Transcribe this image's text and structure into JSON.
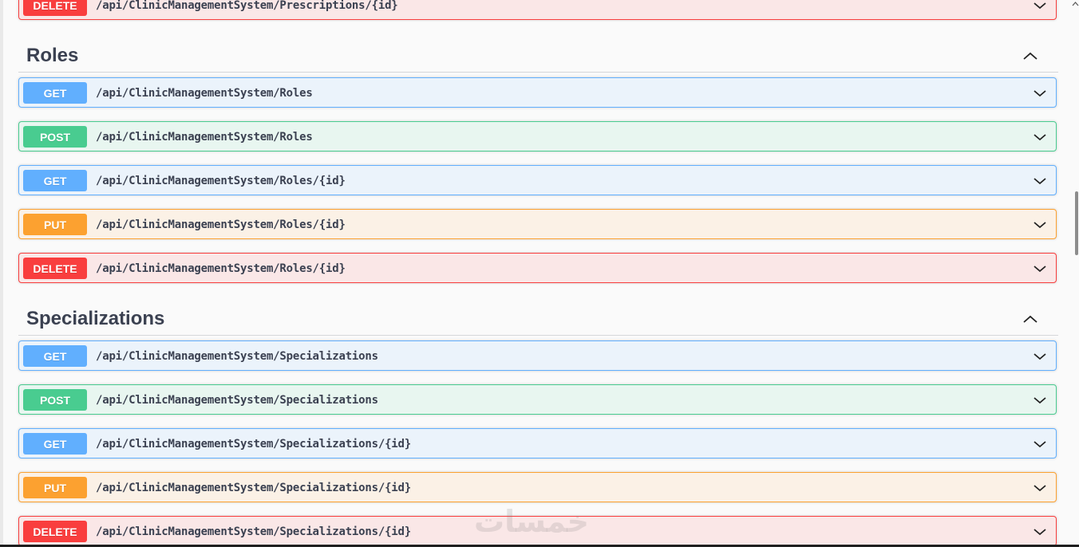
{
  "top_operation": {
    "method": "DELETE",
    "path": "/api/ClinicManagementSystem/Prescriptions/{id}"
  },
  "sections": [
    {
      "title": "Roles",
      "operations": [
        {
          "method": "GET",
          "path": "/api/ClinicManagementSystem/Roles"
        },
        {
          "method": "POST",
          "path": "/api/ClinicManagementSystem/Roles"
        },
        {
          "method": "GET",
          "path": "/api/ClinicManagementSystem/Roles/{id}"
        },
        {
          "method": "PUT",
          "path": "/api/ClinicManagementSystem/Roles/{id}"
        },
        {
          "method": "DELETE",
          "path": "/api/ClinicManagementSystem/Roles/{id}"
        }
      ]
    },
    {
      "title": "Specializations",
      "operations": [
        {
          "method": "GET",
          "path": "/api/ClinicManagementSystem/Specializations"
        },
        {
          "method": "POST",
          "path": "/api/ClinicManagementSystem/Specializations"
        },
        {
          "method": "GET",
          "path": "/api/ClinicManagementSystem/Specializations/{id}"
        },
        {
          "method": "PUT",
          "path": "/api/ClinicManagementSystem/Specializations/{id}"
        },
        {
          "method": "DELETE",
          "path": "/api/ClinicManagementSystem/Specializations/{id}"
        }
      ]
    }
  ],
  "watermark": "خمسات",
  "colors": {
    "get": "#61affe",
    "post": "#49cc90",
    "put": "#fca130",
    "delete": "#f93e3e",
    "text": "#3b4151"
  },
  "icons": {
    "expand": "chevron-down-icon",
    "collapse": "chevron-up-icon"
  }
}
